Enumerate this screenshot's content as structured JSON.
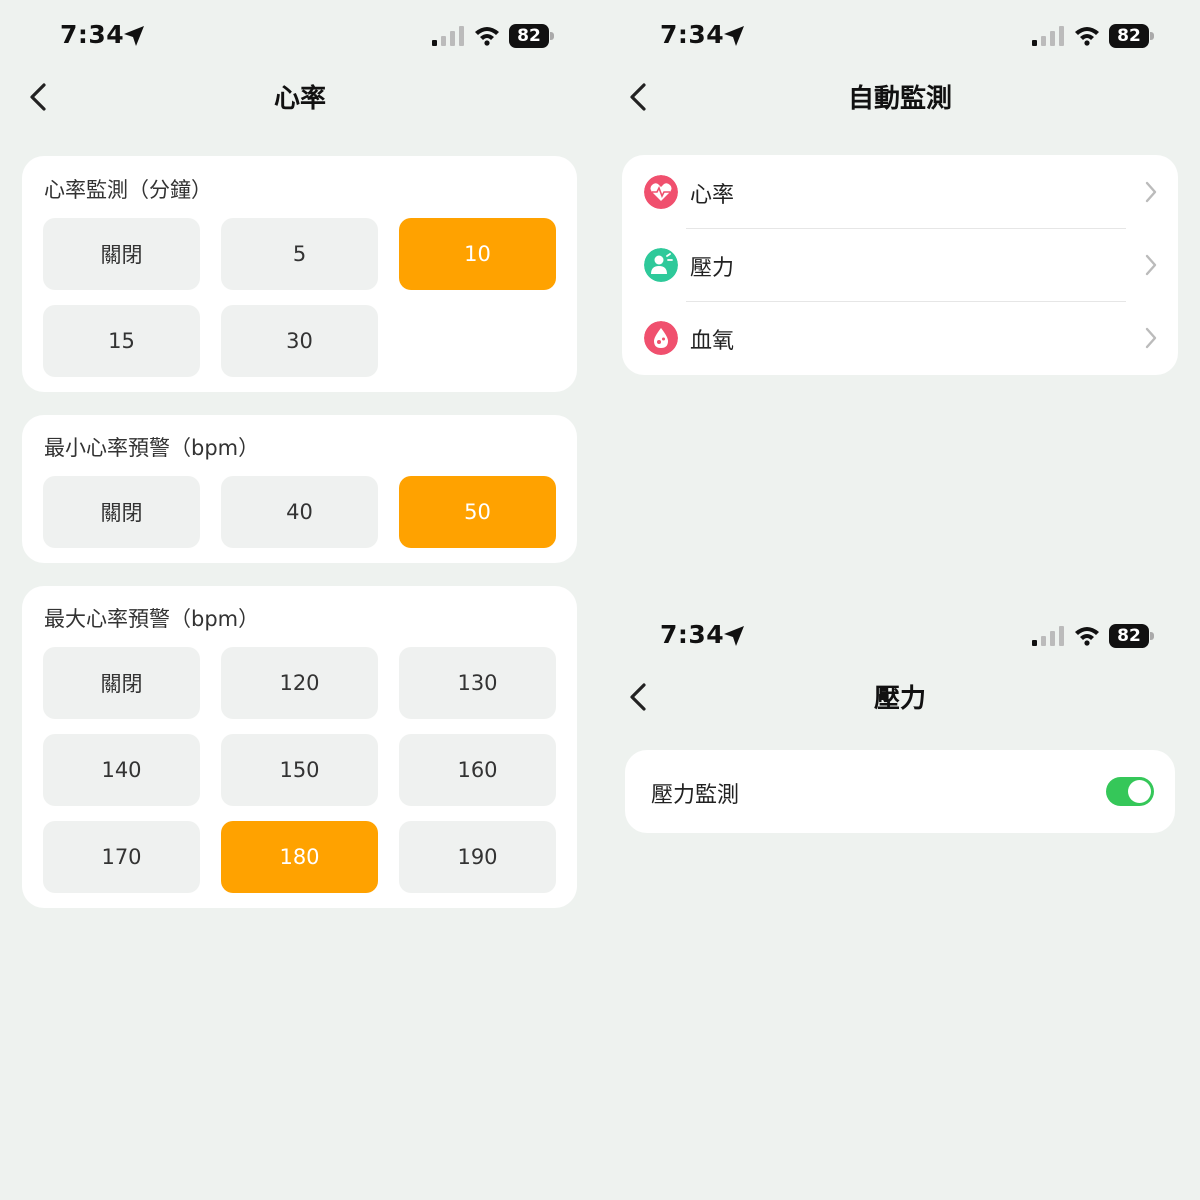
{
  "status_bar": {
    "time": "7:34",
    "battery": "82"
  },
  "heart_rate_screen": {
    "title": "心率",
    "monitor_section": {
      "title": "心率監測（分鐘）",
      "options": [
        "關閉",
        "5",
        "10",
        "15",
        "30"
      ],
      "selected": "10"
    },
    "min_alert_section": {
      "title": "最小心率預警（bpm）",
      "options": [
        "關閉",
        "40",
        "50"
      ],
      "selected": "50"
    },
    "max_alert_section": {
      "title": "最大心率預警（bpm）",
      "options": [
        "關閉",
        "120",
        "130",
        "140",
        "150",
        "160",
        "170",
        "180",
        "190"
      ],
      "selected": "180"
    }
  },
  "auto_monitor_screen": {
    "title": "自動監測",
    "items": [
      {
        "label": "心率",
        "icon": "heart-rate-icon",
        "color": "#f0506e"
      },
      {
        "label": "壓力",
        "icon": "stress-icon",
        "color": "#2ec99a"
      },
      {
        "label": "血氧",
        "icon": "blood-oxygen-icon",
        "color": "#f0506e"
      }
    ]
  },
  "stress_screen": {
    "title": "壓力",
    "setting_label": "壓力監測",
    "toggle_on": true
  },
  "colors": {
    "accent": "#ffa200",
    "toggle_on": "#35c759",
    "background": "#eef2ef"
  }
}
